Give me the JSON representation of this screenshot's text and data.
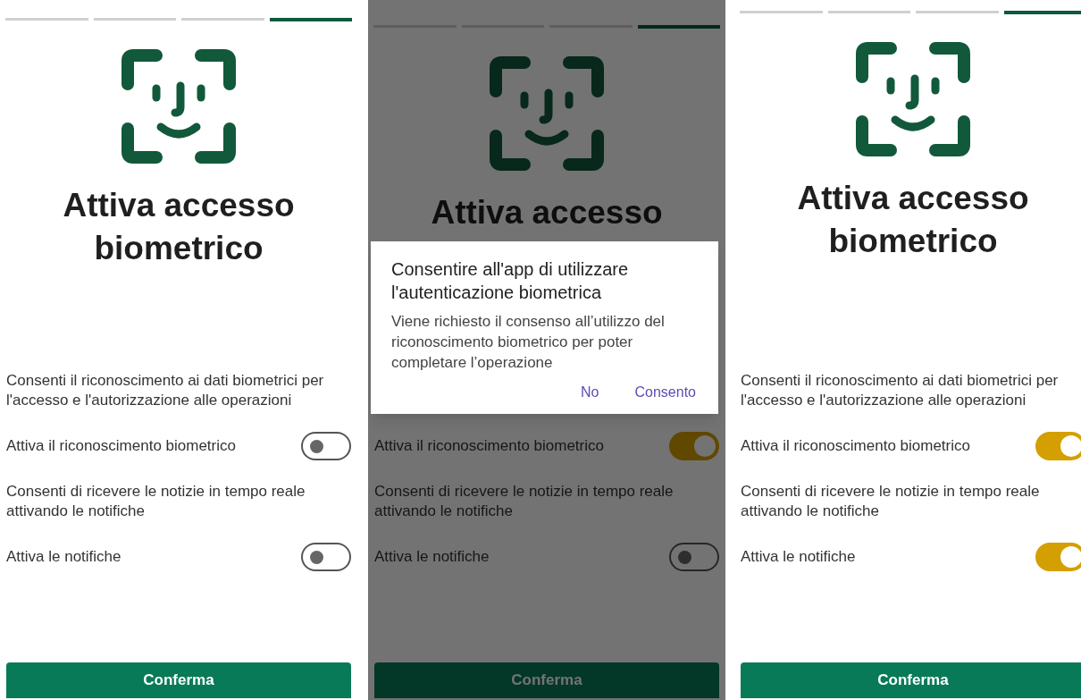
{
  "screens": [
    {
      "steps": [
        {
          "selected": false
        },
        {
          "selected": false
        },
        {
          "selected": false
        },
        {
          "selected": true
        }
      ],
      "title": "Attiva accesso biometrico",
      "dimmed": false,
      "items": [
        {
          "kind": "description",
          "text": "Consenti il riconoscimento ai dati biometrici per l'accesso e l'autorizzazione alle operazioni"
        },
        {
          "kind": "toggle",
          "label": "Attiva il riconoscimento biometrico",
          "on": false
        },
        {
          "kind": "description",
          "text": "Consenti di ricevere le notizie in tempo reale attivando le notifiche"
        },
        {
          "kind": "toggle",
          "label": "Attiva le notifiche",
          "on": false
        }
      ],
      "button": "Conferma"
    },
    {
      "steps": [
        {
          "selected": false
        },
        {
          "selected": false
        },
        {
          "selected": false
        },
        {
          "selected": true
        }
      ],
      "title": "Attiva accesso",
      "dimmed": true,
      "items": [
        {
          "kind": "toggle",
          "label": "Attiva il riconoscimento biometrico",
          "on": true
        },
        {
          "kind": "description",
          "text": "Consenti di ricevere le notizie in tempo reale attivando le notifiche"
        },
        {
          "kind": "toggle",
          "label": "Attiva le notifiche",
          "on": false
        }
      ],
      "button": "Conferma",
      "dialog": {
        "title": "Consentire all'app di utilizzare l'autenticazione biometrica",
        "message": "Viene richiesto il consenso all’utilizzo del riconoscimento biometrico per poter completare l’operazione",
        "actions": [
          "No",
          "Consento"
        ]
      }
    },
    {
      "steps": [
        {
          "selected": false
        },
        {
          "selected": false
        },
        {
          "selected": false
        },
        {
          "selected": true
        }
      ],
      "title": "Attiva accesso biometrico",
      "dimmed": false,
      "items": [
        {
          "kind": "description",
          "text": "Consenti il riconoscimento ai dati biometrici per l'accesso e l'autorizzazione alle operazioni"
        },
        {
          "kind": "toggle",
          "label": "Attiva il riconoscimento biometrico",
          "on": true
        },
        {
          "kind": "description",
          "text": "Consenti di ricevere le notizie in tempo reale attivando le notifiche"
        },
        {
          "kind": "toggle",
          "label": "Attiva le notifiche",
          "on": true
        }
      ],
      "button": "Conferma"
    }
  ]
}
